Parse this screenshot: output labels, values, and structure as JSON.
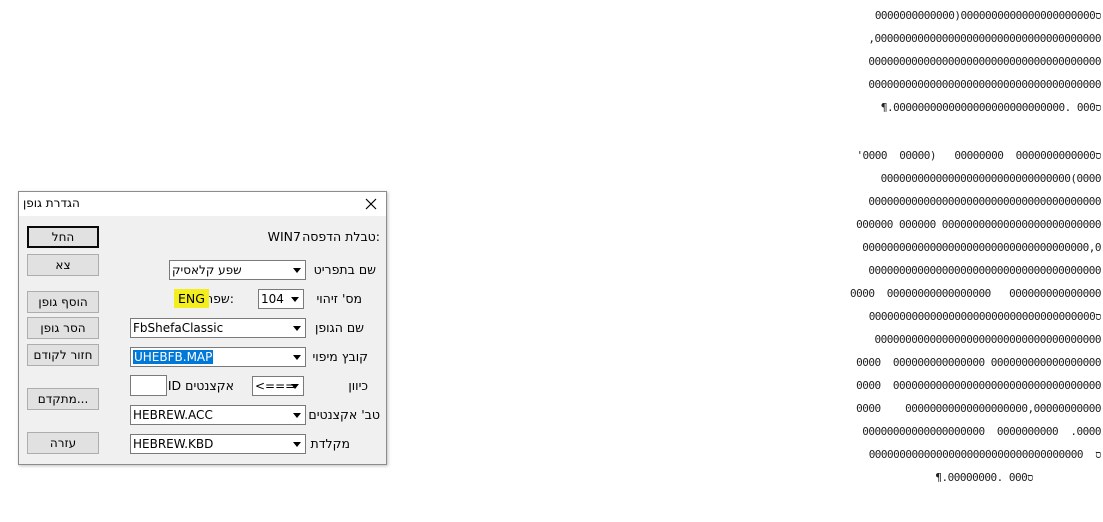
{
  "dialog": {
    "title": "הגדרת גופן",
    "buttons": {
      "start": "החל",
      "exit": "צא",
      "add_font": "הוסף גופן",
      "remove_font": "הסר גופן",
      "back": "חזור לקודם",
      "advanced": "מתקדם...",
      "help": "עזרה"
    },
    "print_table_label": "טבלת הדפסה:",
    "print_table_value": "WIN7",
    "menu_name_label": "שם בתפריט",
    "menu_name_value": "שפע קלאסיק",
    "id_label": "מס' זיהוי",
    "id_value": "104",
    "language_label": "שפה:",
    "language_value": "ENG",
    "font_name_label": "שם הגופן",
    "font_name_value": "FbShefaClassic",
    "map_file_label": "קובץ מיפוי",
    "map_file_value": "UHEBFB.MAP",
    "direction_label": "כיוון",
    "direction_value": "<===",
    "accents_id_label": "ID אקצנטים",
    "accents_id_value": "",
    "accents_table_label": "טב' אקצנטים",
    "accents_table_value": "HEBREW.ACC",
    "keyboard_label": "מקלדת",
    "keyboard_value": "HEBREW.KBD"
  },
  "document": {
    "lines": [
      "ס0000000000000000000000(0000000000000",
      ",0000000000000000000000000000000000000",
      "00000000000000000000000000000000000000",
      "00000000000000000000000000000000000000",
      "¶.ס000 .0000000000000000000000000000",
      "",
      "'0000  00000)   ס0000000000000  00000000",
      "0000000000000000000000000000000(0000",
      "00000000000000000000000000000000000000",
      "000000 000000 00000000000000000000000000",
      "0000000000000000000000000000000000000,0",
      "00000000000000000000000000000000000000",
      "0000  00000000000000000   000000000000000",
      "ס0000000000000000000000000000000000000",
      "0000000000000000000000000000000000000",
      "0000  000000000000000 000000000000000000",
      "0000  0000000000000000000000000000000000",
      "0000    00000000000000000000,00000000000",
      "00000000000000000000  0000000000  .0000",
      "00000000ס  000000000000000000000000000",
      "¶.ס000 .00000000"
    ]
  }
}
